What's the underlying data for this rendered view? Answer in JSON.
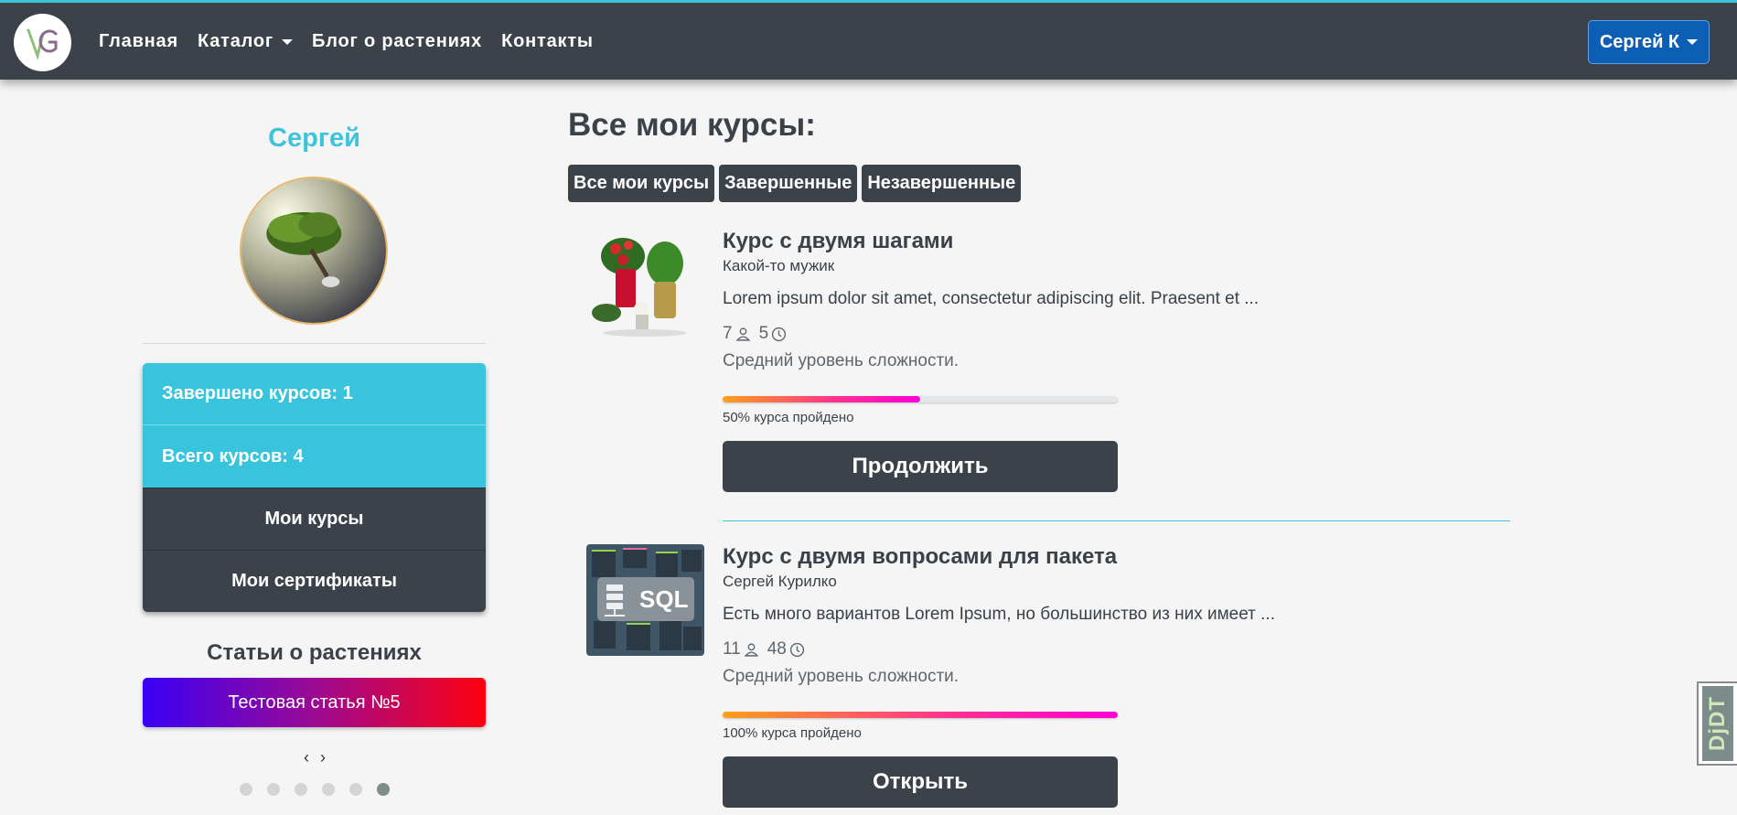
{
  "colors": {
    "navbar": "#3b424a",
    "accent_cyan": "#3ec4da",
    "user_button": "#0d5fb5"
  },
  "navbar": {
    "logo_icon": "vg-logo-icon",
    "links": [
      "Главная",
      "Каталог",
      "Блог о растениях",
      "Контакты"
    ],
    "user_menu": "Сергей К"
  },
  "profile": {
    "name": "Сергей",
    "stats": [
      "Завершено курсов: 1",
      "Всего курсов: 4"
    ],
    "menu": [
      "Мои курсы",
      "Мои сертификаты"
    ]
  },
  "articles": {
    "title": "Статьи о растениях",
    "current": "Тестовая статья №5",
    "prev": "‹",
    "next": "›",
    "dots_total": 6,
    "active_dot": 6
  },
  "main": {
    "title": "Все мои курсы:",
    "filters": [
      "Все мои курсы",
      "Завершенные",
      "Незавершенные"
    ]
  },
  "courses": [
    {
      "title": "Курс с двумя шагами",
      "author": "Какой-то мужик",
      "description": "Lorem ipsum dolor sit amet, consectetur adipiscing elit. Praesent et ...",
      "students": "7",
      "duration": "5",
      "level": "Средний уровень сложности.",
      "progress": 50,
      "progress_text": "50% курса пройдено",
      "button": "Продолжить"
    },
    {
      "title": "Курс с двумя вопросами для пакета",
      "author": "Сергей Курилко",
      "description": "Есть много вариантов Lorem Ipsum, но большинство из них имеет ...",
      "students": "11",
      "duration": "48",
      "level": "Средний уровень сложности.",
      "progress": 100,
      "progress_text": "100% курса пройдено",
      "button": "Открыть",
      "thumb_label": "SQL"
    }
  ],
  "debug_toolbar": "DjDT"
}
